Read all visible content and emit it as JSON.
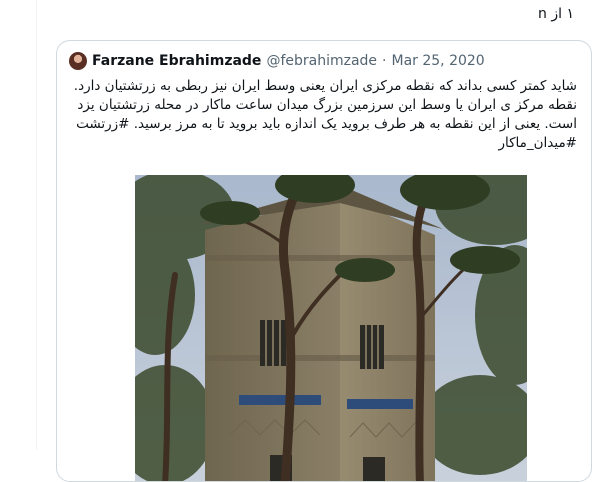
{
  "thread": {
    "counter": "۱ از n"
  },
  "quoted_tweet": {
    "author_name": "Farzane Ebrahimzade",
    "handle": "@febrahimzade",
    "separator": "·",
    "date": "Mar 25, 2020",
    "text": "شاید کمتر کسی بداند که نقطه مرکزی ایران یعنی وسط ایران نیز ربطی به زرتشتیان دارد.  نقطه مرکز ی ایران  یا وسط این سرزمین بزرگ میدان ساعت ماکار در محله زرتشتیان یزد است. یعنی از این نقطه به هر طرف بروید یک اندازه باید بروید تا به مرز برسید. #زرتشت #میدان_ماکار",
    "media": {
      "description_icon": "photo-image"
    }
  },
  "colors": {
    "border": "#cfd9de",
    "secondary_text": "#536471",
    "sky": "#b6c3d6",
    "tower": "#8a7d63"
  }
}
